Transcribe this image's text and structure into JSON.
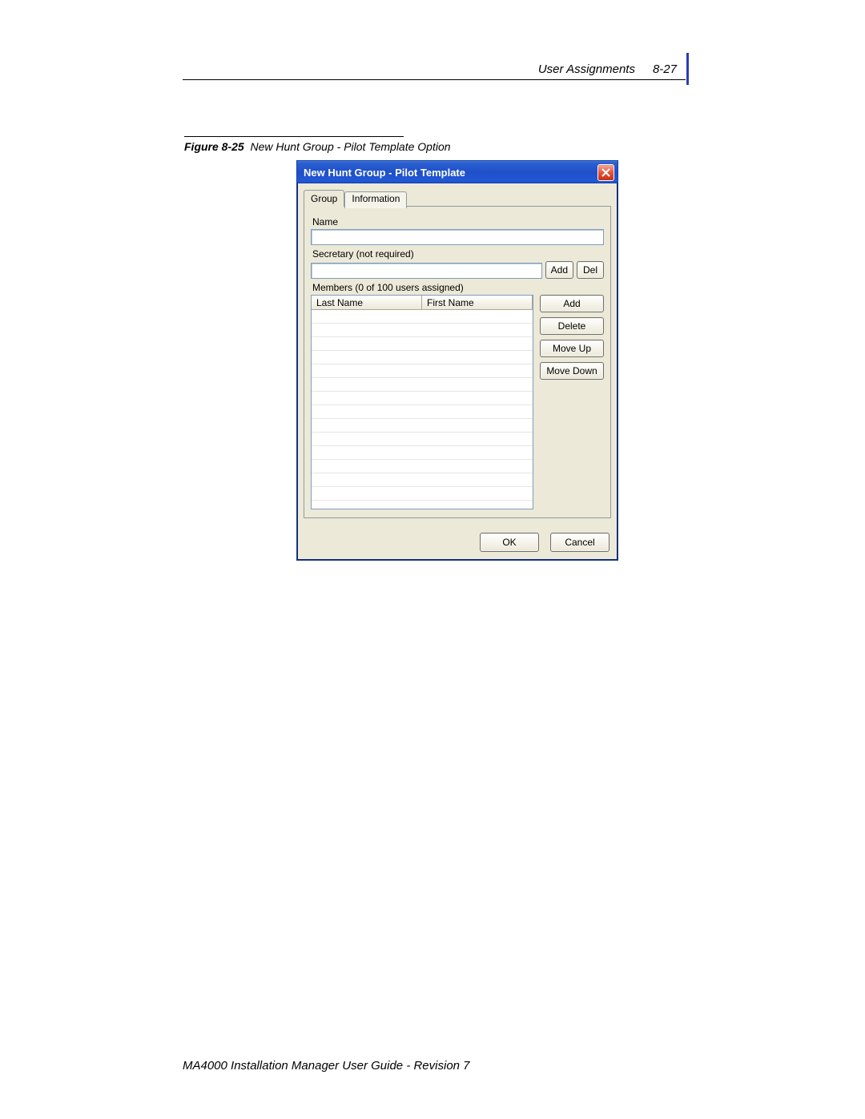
{
  "header": {
    "section": "User Assignments",
    "page_num": "8-27"
  },
  "figure": {
    "label": "Figure 8-25",
    "caption": "New Hunt Group - Pilot Template Option"
  },
  "dialog": {
    "title": "New Hunt Group - Pilot Template",
    "tabs": {
      "group": "Group",
      "information": "Information"
    },
    "labels": {
      "name": "Name",
      "secretary": "Secretary (not required)",
      "members": "Members (0 of 100 users assigned)"
    },
    "fields": {
      "name_value": "",
      "secretary_value": ""
    },
    "grid": {
      "col1": "Last Name",
      "col2": "First Name"
    },
    "buttons": {
      "sec_add": "Add",
      "sec_del": "Del",
      "m_add": "Add",
      "m_delete": "Delete",
      "m_moveup": "Move Up",
      "m_movedown": "Move Down",
      "ok": "OK",
      "cancel": "Cancel"
    }
  },
  "footer": "MA4000 Installation Manager User Guide - Revision 7"
}
